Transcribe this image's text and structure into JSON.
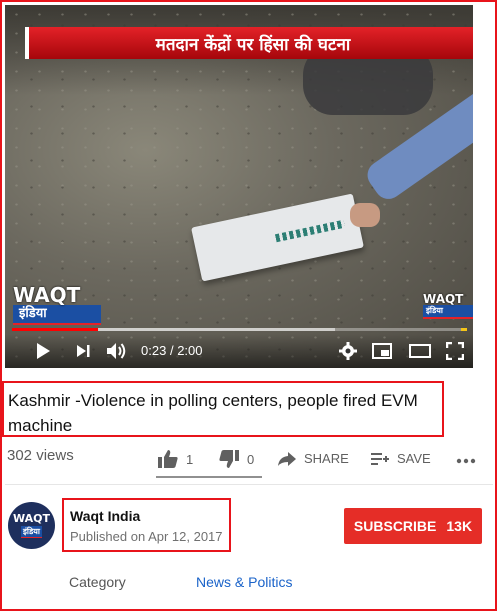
{
  "video": {
    "overlay_headline": "मतदान केंद्रों पर हिंसा की घटना",
    "logo_word": "WAQT",
    "logo_sub": "इंडिया",
    "current_time": "0:23",
    "separator": "/",
    "duration": "2:00",
    "played_fraction": 0.19,
    "buffered_fraction": 0.71
  },
  "title": "Kashmir -Violence in polling centers, people fired EVM machine",
  "stats": {
    "views": "302 views",
    "likes": "1",
    "dislikes": "0",
    "share_label": "SHARE",
    "save_label": "SAVE"
  },
  "channel": {
    "name": "Waqt India",
    "published": "Published on Apr 12, 2017",
    "avatar_word": "WAQT",
    "avatar_sub": "इंडिया"
  },
  "subscribe": {
    "label": "SUBSCRIBE",
    "count": "13K"
  },
  "meta": {
    "category_label": "Category",
    "category_value": "News & Politics"
  },
  "colors": {
    "accent_red": "#e52d27",
    "highlight_border": "#e8141b",
    "link_blue": "#1a63c9"
  },
  "icons": [
    "play-icon",
    "next-icon",
    "volume-icon",
    "settings-icon",
    "miniplayer-icon",
    "theater-icon",
    "fullscreen-icon",
    "like-icon",
    "dislike-icon",
    "share-icon",
    "save-icon",
    "more-icon"
  ]
}
